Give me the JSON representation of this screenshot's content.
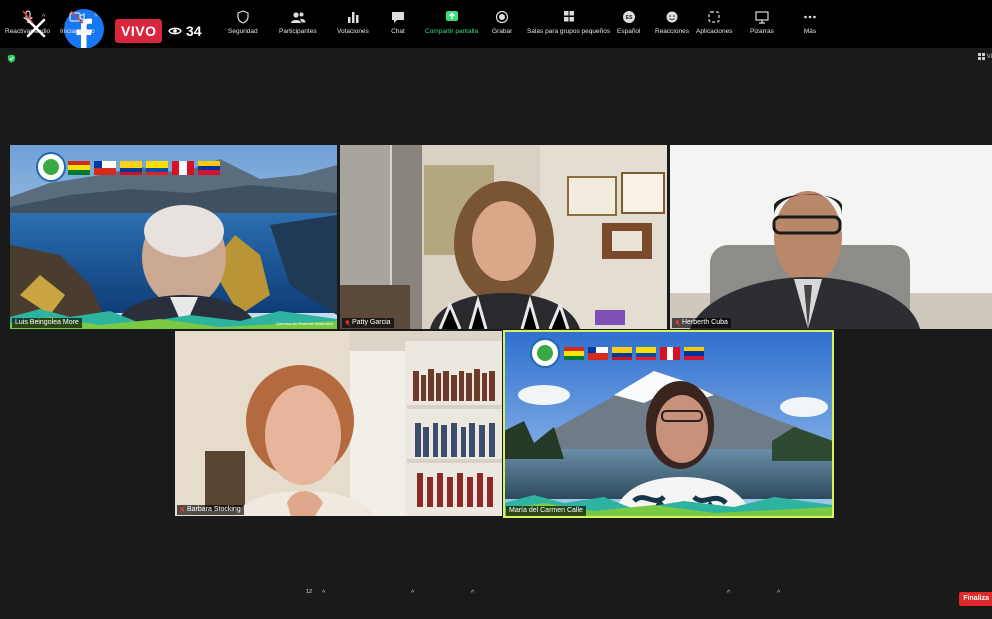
{
  "topbar": {
    "live_label": "VIVO",
    "viewer_count": "34"
  },
  "view_label": "Vi",
  "participants": [
    {
      "name": "Luis Beingolea More",
      "banner": "Defensa del Sistema Sostenible"
    },
    {
      "name": "Patty Garcia"
    },
    {
      "name": "Herberth Cuba"
    },
    {
      "name": "Barbara Stocking"
    },
    {
      "name": "María del Carmen Calle",
      "active": true
    }
  ],
  "toolbar": {
    "items": [
      {
        "id": "audio",
        "label": "Reactivar audio"
      },
      {
        "id": "video",
        "label": "Iniciar video"
      },
      {
        "id": "security",
        "label": "Seguridad"
      },
      {
        "id": "participants",
        "label": "Participantes",
        "count": "12"
      },
      {
        "id": "polls",
        "label": "Votaciones"
      },
      {
        "id": "chat",
        "label": "Chat"
      },
      {
        "id": "share",
        "label": "Compartir pantalla"
      },
      {
        "id": "record",
        "label": "Grabar"
      },
      {
        "id": "breakout",
        "label": "Salas para grupos pequeños"
      },
      {
        "id": "language",
        "label": "Español",
        "code": "ES"
      },
      {
        "id": "reactions",
        "label": "Reacciones"
      },
      {
        "id": "apps",
        "label": "Aplicaciones"
      },
      {
        "id": "whiteboards",
        "label": "Pizarras"
      },
      {
        "id": "more",
        "label": "Más"
      }
    ],
    "end_label": "Finaliza"
  },
  "colors": {
    "live": "#d7263d",
    "facebook": "#1877f2",
    "active_speaker": "#d7f25a",
    "share_green": "#3ddc84",
    "end_red": "#e02828"
  }
}
